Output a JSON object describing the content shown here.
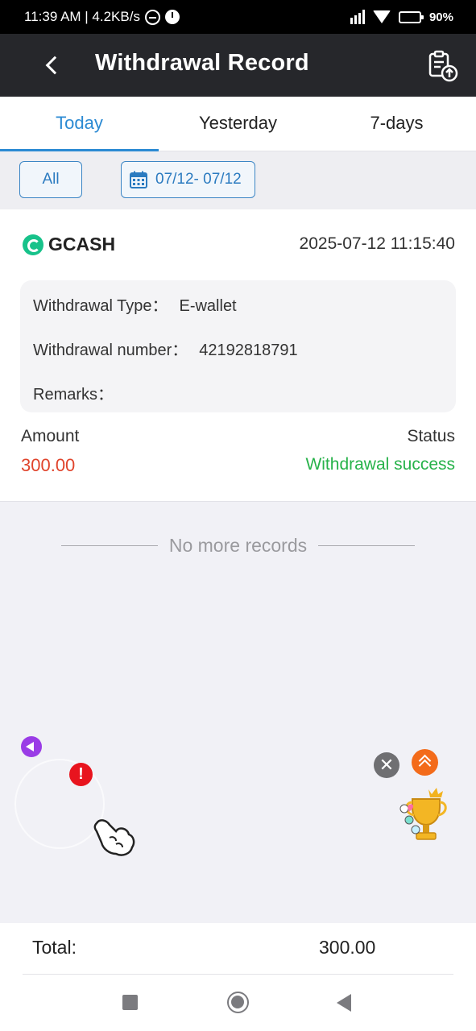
{
  "status_bar": {
    "time_speed": "11:39 AM | 4.2KB/s",
    "battery": "90%"
  },
  "header": {
    "title": "Withdrawal Record",
    "back_icon": "chevron-left-icon",
    "upload_icon": "clipboard-upload-icon"
  },
  "tabs": [
    {
      "label": "Today",
      "active": true
    },
    {
      "label": "Yesterday",
      "active": false
    },
    {
      "label": "7-days",
      "active": false
    }
  ],
  "filters": {
    "all_label": "All",
    "date_range": "07/12- 07/12"
  },
  "record": {
    "method": "GCASH",
    "datetime": "2025-07-12 11:15:40",
    "type_label": "Withdrawal Type：",
    "type_value": "E-wallet",
    "number_label": "Withdrawal number：",
    "number_value": "42192818791",
    "remarks_label": "Remarks：",
    "remarks_value": "",
    "amount_label": "Amount",
    "amount_value": "300.00",
    "status_label": "Status",
    "status_value": "Withdrawal success"
  },
  "footer_note": "No more records",
  "total": {
    "label": "Total:",
    "value": "300.00"
  },
  "colors": {
    "accent": "#2b8ad3",
    "amount": "#e0442c",
    "success": "#27b24a",
    "header_bg": "#26272b"
  }
}
